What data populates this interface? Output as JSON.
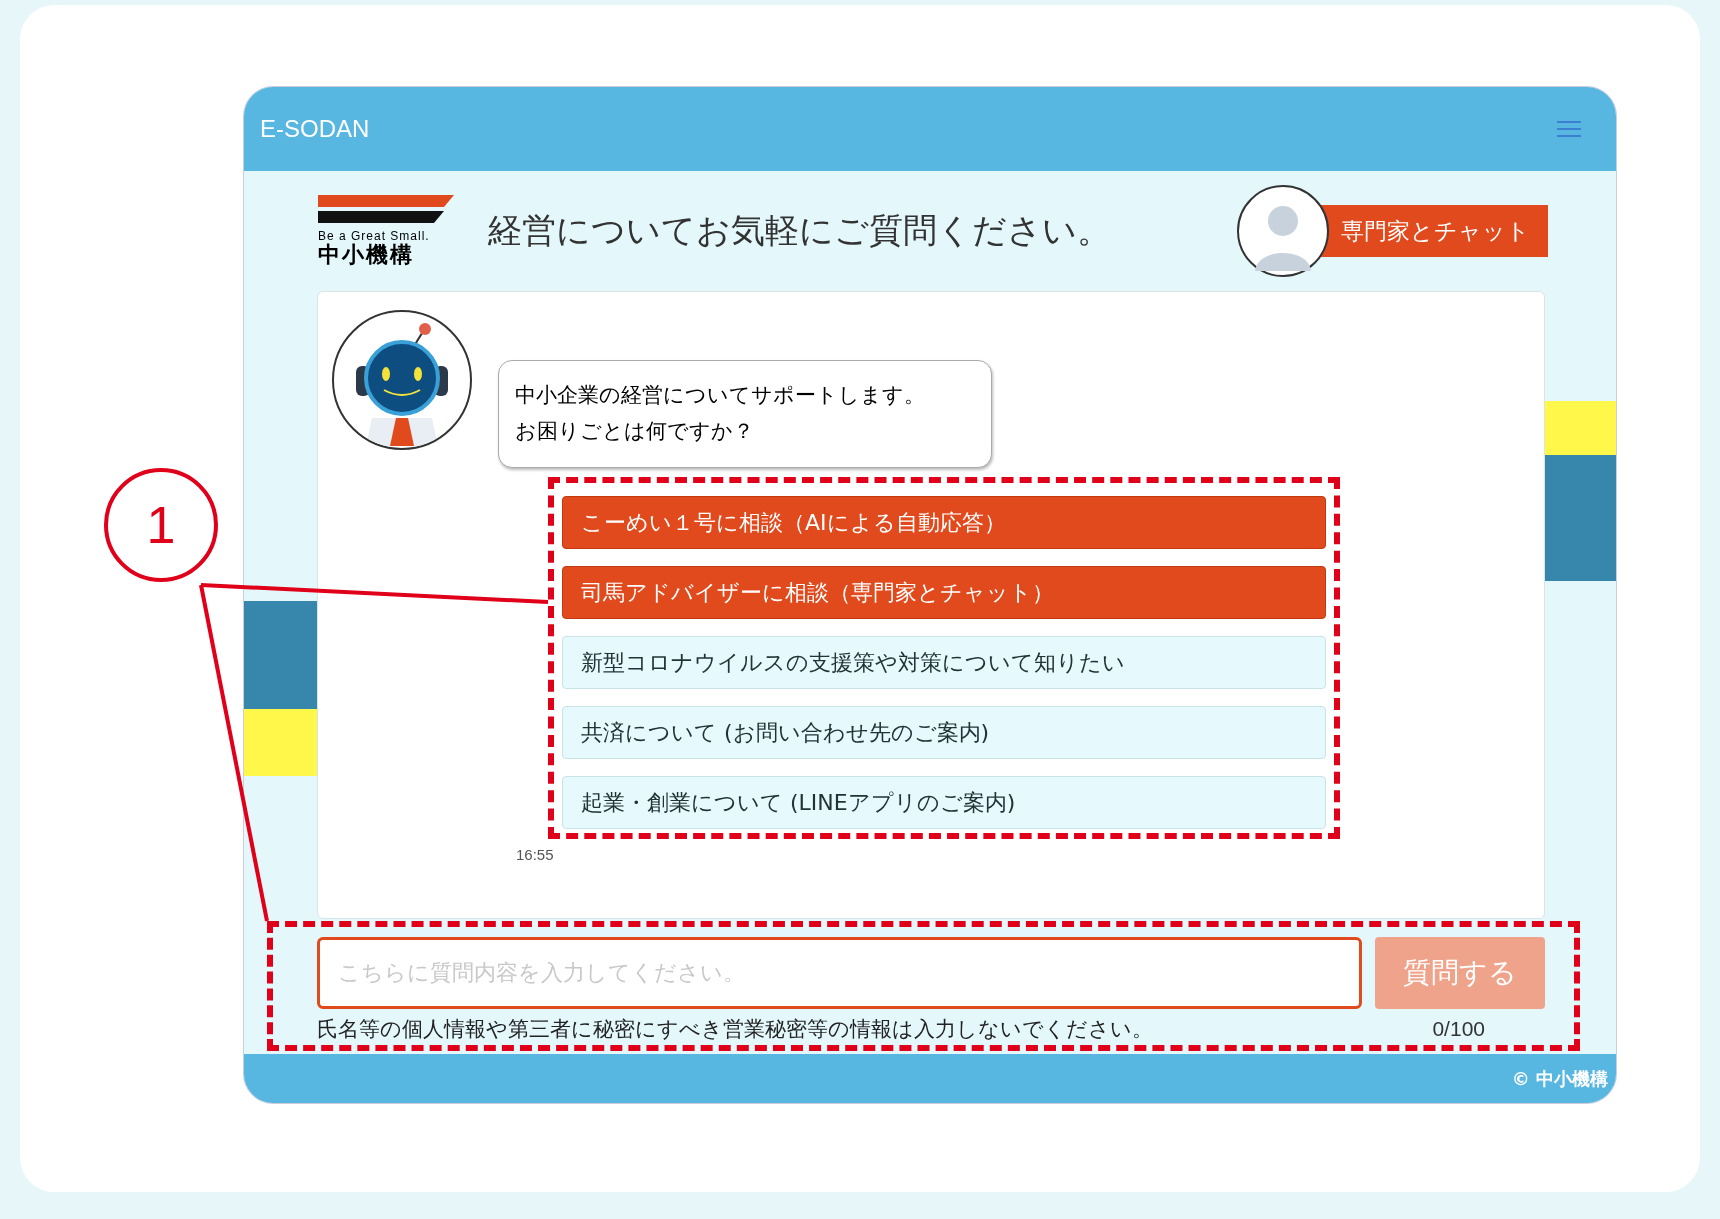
{
  "app": {
    "title": "E-SODAN"
  },
  "header": {
    "logo_tagline": "Be a Great Small.",
    "logo_name": "中小機構",
    "heading": "経営についてお気軽にご質問ください。",
    "expert_button": "専門家とチャット"
  },
  "chat": {
    "message": [
      "中小企業の経営についてサポートします。",
      "お困りごとは何ですか？"
    ],
    "time": "16:55",
    "choices": [
      {
        "label": "こーめい１号に相談（AIによる自動応答）",
        "kind": "primary"
      },
      {
        "label": "司馬アドバイザーに相談（専門家とチャット）",
        "kind": "primary"
      },
      {
        "label": "新型コロナウイルスの支援策や対策について知りたい",
        "kind": "secondary"
      },
      {
        "label": "共済について (お問い合わせ先のご案内)",
        "kind": "secondary"
      },
      {
        "label": "起業・創業について (LINEアプリのご案内)",
        "kind": "secondary"
      }
    ]
  },
  "composer": {
    "placeholder": "こちらに質問内容を入力してください。",
    "submit": "質問する",
    "disabled": true,
    "notice": "氏名等の個人情報や第三者に秘密にすべき営業秘密等の情報は入力しないでください。",
    "counter": "0/100"
  },
  "footer": {
    "copyright": "© 中小機構"
  },
  "annotation": {
    "label": "1"
  }
}
